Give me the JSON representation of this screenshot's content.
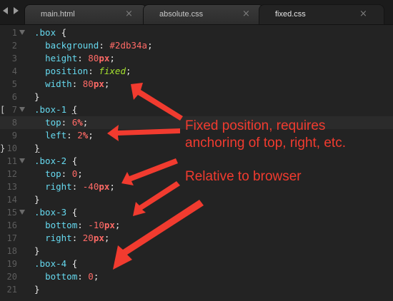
{
  "tabs": [
    {
      "label": "main.html",
      "active": false
    },
    {
      "label": "absolute.css",
      "active": false
    },
    {
      "label": "fixed.css",
      "active": true
    }
  ],
  "tab_close_glyph": "×",
  "line_numbers": [
    "1",
    "2",
    "3",
    "4",
    "5",
    "6",
    "7",
    "8",
    "9",
    "10",
    "11",
    "12",
    "13",
    "14",
    "15",
    "16",
    "17",
    "18",
    "19",
    "20",
    "21"
  ],
  "code": {
    "l1_selector": ".box",
    "brace_open": "{",
    "brace_close": "}",
    "l2_prop": "background",
    "l2_val": "#2db34a",
    "l3_prop": "height",
    "l3_num": "80",
    "l3_unit": "px",
    "l4_prop": "position",
    "l4_val": "fixed",
    "l5_prop": "width",
    "l5_num": "80",
    "l5_unit": "px",
    "l7_selector": ".box-1",
    "l8_prop": "top",
    "l8_num": "6",
    "l8_unit": "%",
    "l9_prop": "left",
    "l9_num": "2",
    "l9_unit": "%",
    "l11_selector": ".box-2",
    "l12_prop": "top",
    "l12_num": "0",
    "l13_prop": "right",
    "l13_num": "-40",
    "l13_unit": "px",
    "l15_selector": ".box-3",
    "l16_prop": "bottom",
    "l16_num": "-10",
    "l16_unit": "px",
    "l17_prop": "right",
    "l17_num": "20",
    "l17_unit": "px",
    "l19_selector": ".box-4",
    "l20_prop": "bottom",
    "l20_num": "0"
  },
  "annotations": {
    "fixed_line1": "Fixed position, requires",
    "fixed_line2": "anchoring of top, right, etc.",
    "relative": "Relative to browser"
  },
  "colors": {
    "annotation": "#f13b2f",
    "selector": "#66d9ef",
    "number": "#ff6a66",
    "keyword": "#a6e22e",
    "background": "#232323"
  }
}
